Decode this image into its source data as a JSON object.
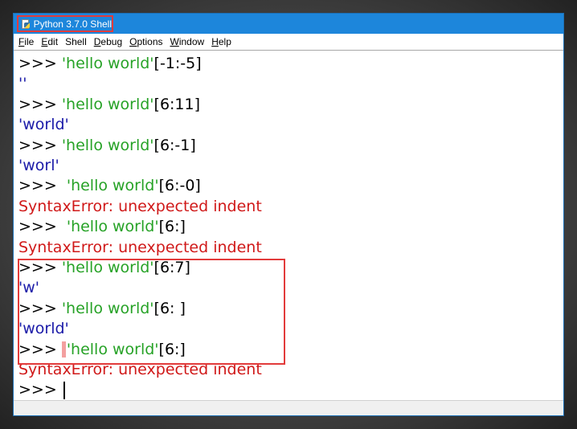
{
  "window": {
    "title": "Python 3.7.0 Shell"
  },
  "menubar": {
    "items": [
      {
        "ul": "F",
        "rest": "ile"
      },
      {
        "ul": "E",
        "rest": "dit"
      },
      {
        "ul": "",
        "rest": "Shell"
      },
      {
        "ul": "D",
        "rest": "ebug"
      },
      {
        "ul": "O",
        "rest": "ptions"
      },
      {
        "ul": "W",
        "rest": "indow"
      },
      {
        "ul": "H",
        "rest": "elp"
      }
    ]
  },
  "shell": {
    "prompt": ">>>",
    "lines": [
      {
        "kind": "input",
        "prompt": ">>> ",
        "str": "'hello world'",
        "code": "[-1:-5]"
      },
      {
        "kind": "output",
        "text": "''"
      },
      {
        "kind": "input",
        "prompt": ">>> ",
        "str": "'hello world'",
        "code": "[6:11]"
      },
      {
        "kind": "output",
        "text": "'world'"
      },
      {
        "kind": "input",
        "prompt": ">>> ",
        "str": "'hello world'",
        "code": "[6:-1]"
      },
      {
        "kind": "output",
        "text": "'worl'"
      },
      {
        "kind": "input",
        "prompt": ">>>  ",
        "str": "'hello world'",
        "code": "[6:-0]"
      },
      {
        "kind": "error",
        "text": "SyntaxError: unexpected indent"
      },
      {
        "kind": "input",
        "prompt": ">>>  ",
        "str": "'hello world'",
        "code": "[6:]"
      },
      {
        "kind": "error",
        "text": "SyntaxError: unexpected indent"
      },
      {
        "kind": "input",
        "prompt": ">>> ",
        "str": "'hello world'",
        "code": "[6:7]"
      },
      {
        "kind": "output",
        "text": "'w'"
      },
      {
        "kind": "input",
        "prompt": ">>> ",
        "str": "'hello world'",
        "code": "[6: ]"
      },
      {
        "kind": "output",
        "text": "'world'"
      },
      {
        "kind": "input-hl",
        "prompt": ">>> ",
        "str": "'hello world'",
        "code": "[6:]"
      },
      {
        "kind": "error",
        "text": "SyntaxError: unexpected indent"
      },
      {
        "kind": "prompt",
        "prompt": ">>> "
      }
    ]
  },
  "colors": {
    "titlebar": "#1d86db",
    "string": "#26a226",
    "output": "#1a1aa8",
    "error": "#d01919",
    "annotation": "#e23b3b"
  }
}
